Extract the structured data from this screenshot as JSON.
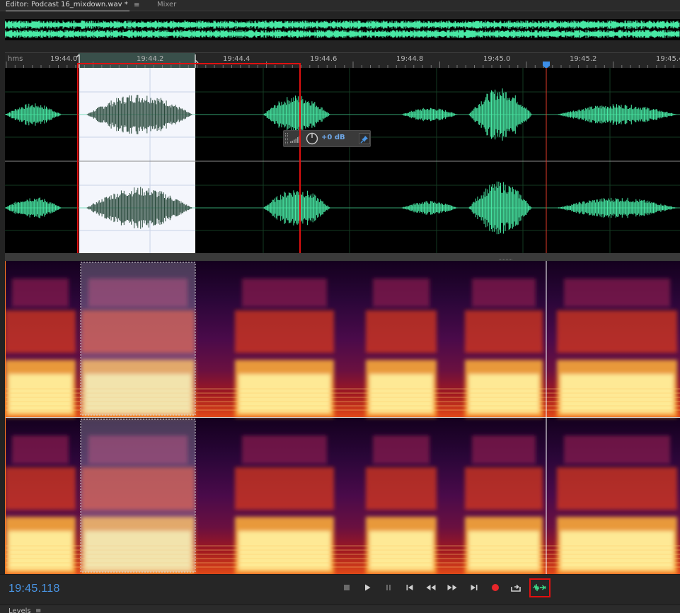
{
  "editor": {
    "tab_label": "Editor: Podcast 16_mixdown.wav *",
    "tab_menu_glyph": "≡",
    "mixer_label": "Mixer"
  },
  "ruler": {
    "unit": "hms",
    "ticks": [
      "19:44.0",
      "19:44.2",
      "19:44.4",
      "19:44.6",
      "19:44.8",
      "19:45.0",
      "19:45.2",
      "19:45.4"
    ]
  },
  "hud": {
    "gain_value": "+0 dB"
  },
  "transport": {
    "current_time": "19:45.118",
    "buttons": [
      "stop",
      "play",
      "pause",
      "go-to-start",
      "rewind",
      "fast-forward",
      "go-to-end",
      "record",
      "loop-playback",
      "skip-selection"
    ]
  },
  "panels": {
    "levels_label": "Levels",
    "levels_menu_glyph": "≡"
  },
  "colors": {
    "waveform": "#48e8a4",
    "selection": "#f4f6fc",
    "playhead": "#e03a2a",
    "time_display": "#4a96e6",
    "highlight_box": "#e01010",
    "record": "#e8262a"
  }
}
